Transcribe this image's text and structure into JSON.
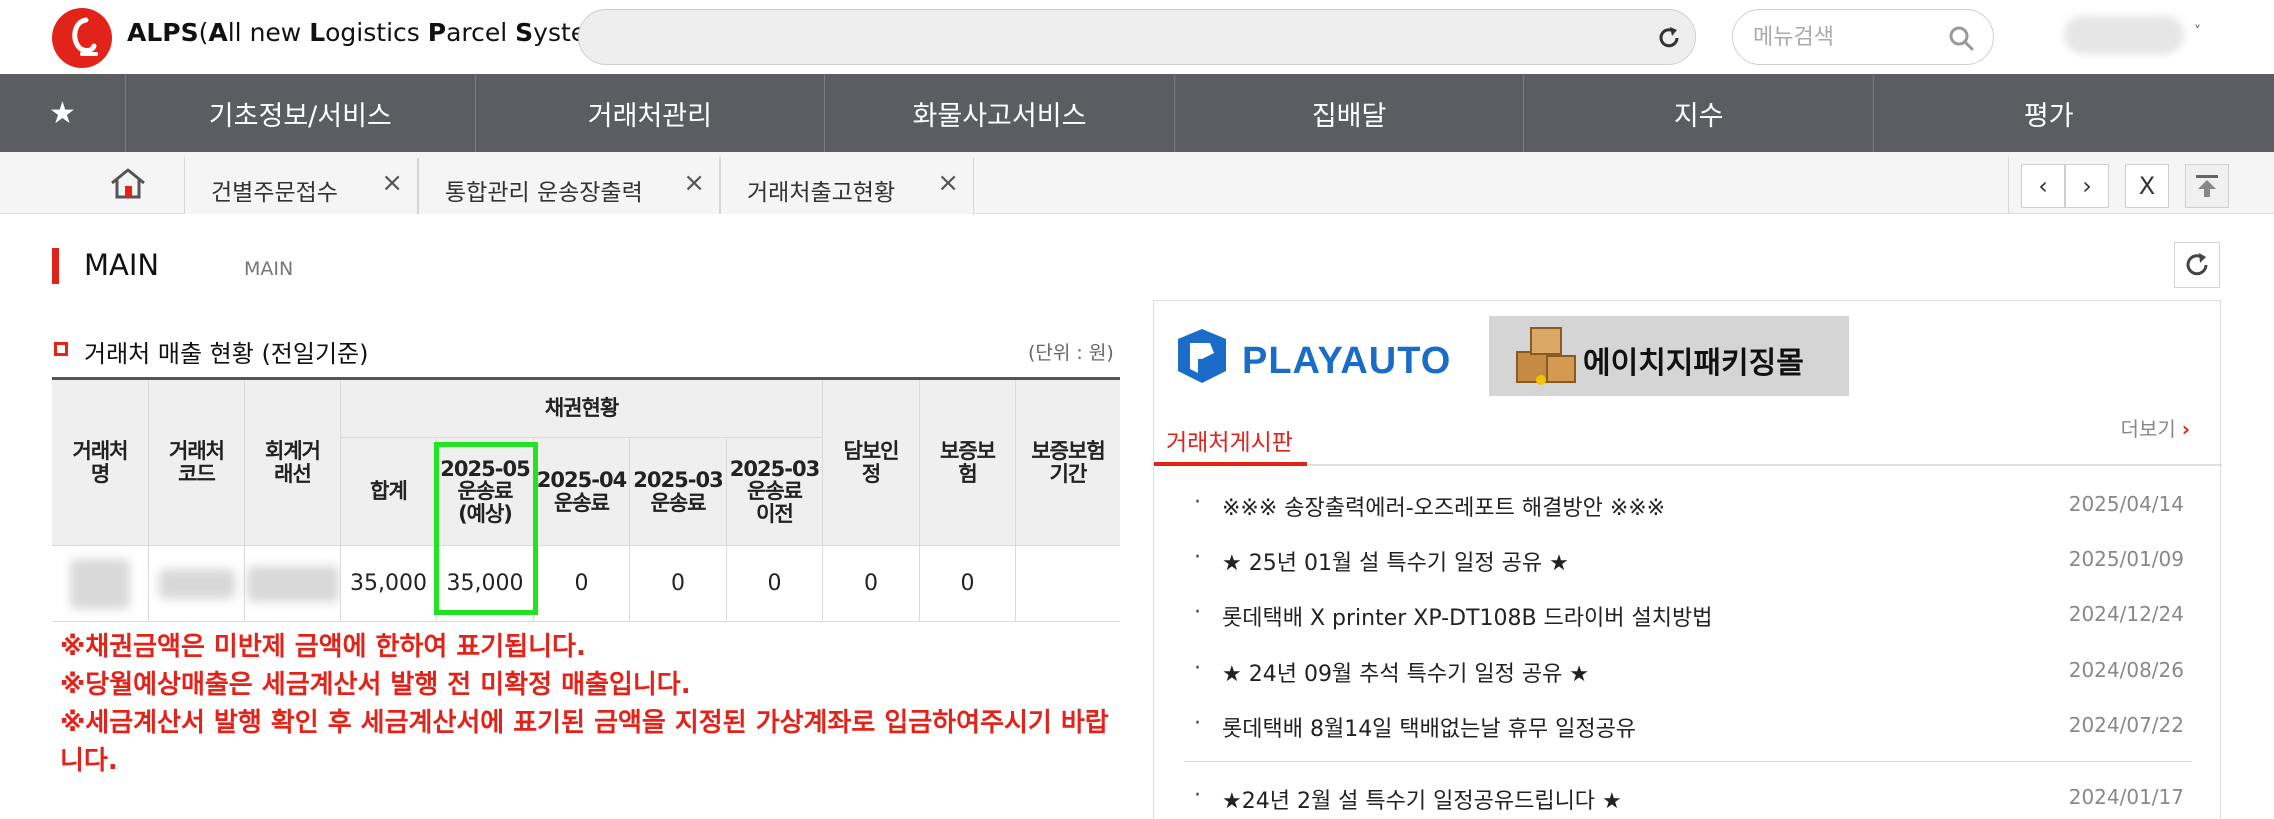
{
  "header": {
    "brand_prefix": "ALPS",
    "brand_expansion_parts": [
      "(",
      "A",
      "ll new ",
      "L",
      "ogistics ",
      "P",
      "arcel ",
      "S",
      "ystem)"
    ],
    "menu_search_placeholder": "메뉴검색",
    "accent_color": "#e2231a"
  },
  "nav": {
    "favorites_glyph": "★",
    "items": [
      "기초정보/서비스",
      "거래처관리",
      "화물사고서비스",
      "집배달",
      "지수",
      "평가"
    ]
  },
  "tabs": {
    "open": [
      {
        "label": "건별주문접수"
      },
      {
        "label": "통합관리 운송장출력"
      },
      {
        "label": "거래처출고현황"
      }
    ],
    "close_glyph": "×",
    "prev_glyph": "‹",
    "next_glyph": "›",
    "close_all_label": "X"
  },
  "page": {
    "title": "MAIN",
    "breadcrumb": "MAIN"
  },
  "sales": {
    "section_title": "거래처 매출 현황 (전일기준)",
    "unit_label": "(단위 : 원)",
    "headers": {
      "client_name": "거래처\n명",
      "client_code": "거래처\n코드",
      "accounting_client": "회계거\n래선",
      "receivables_group": "채권현황",
      "total": "합계",
      "m2025_05": "2025-05\n운송료\n(예상)",
      "m2025_04": "2025-04\n운송료",
      "m2025_03": "2025-03\n운송료",
      "m2025_03_before": "2025-03\n운송료\n이전",
      "collateral": "담보인\n정",
      "guarantee_insurance": "보증보\n험",
      "guarantee_period": "보증보험\n기간"
    },
    "row": {
      "total": "35,000",
      "m2025_05": "35,000",
      "m2025_04": "0",
      "m2025_03": "0",
      "m2025_03_before": "0",
      "collateral": "0",
      "guarantee_insurance": "0",
      "guarantee_period": ""
    },
    "highlight_color": "#21e321",
    "notes": [
      "※채권금액은 미반제 금액에 한하여 표기됩니다.",
      "※당월예상매출은 세금계산서 발행 전 미확정 매출입니다.",
      "※세금계산서 발행 확인 후 세금계산서에 표기된 금액을 지정된 가상계좌로 입금하여주시기 바랍니다."
    ]
  },
  "board": {
    "banner_playauto": "PLAYAUTO",
    "banner_hg": "에이치지패키징몰",
    "tab_label": "거래처게시판",
    "more_label": "더보기",
    "more_glyph": "›",
    "bullet": "·",
    "posts": [
      {
        "title": "※※※ 송장출력에러-오즈레포트 해결방안 ※※※",
        "date": "2025/04/14"
      },
      {
        "title": "★ 25년 01월 설 특수기 일정 공유 ★",
        "date": "2025/01/09"
      },
      {
        "title": "롯데택배 X printer XP-DT108B 드라이버 설치방법",
        "date": "2024/12/24"
      },
      {
        "title": "★ 24년 09월 추석 특수기 일정 공유 ★",
        "date": "2024/08/26"
      },
      {
        "title": "롯데택배 8월14일 택배없는날 휴무 일정공유",
        "date": "2024/07/22"
      },
      {
        "title": "★24년 2월 설 특수기 일정공유드립니다 ★",
        "date": "2024/01/17"
      }
    ]
  }
}
